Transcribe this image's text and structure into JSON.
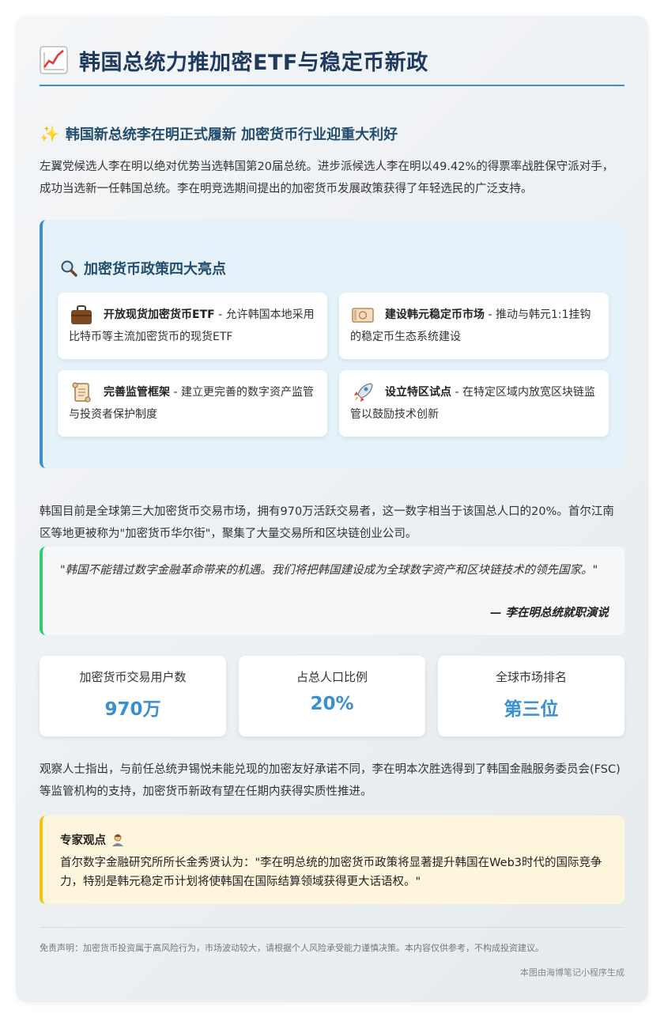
{
  "header": {
    "title": "韩国总统力推加密ETF与稳定币新政",
    "icon": "chart-increasing-icon"
  },
  "section1": {
    "heading": "韩国新总统李在明正式履新 加密货币行业迎重大利好",
    "icon": "sparkles-icon",
    "paragraph": "左翼党候选人李在明以绝对优势当选韩国第20届总统。进步派候选人李在明以49.42%的得票率战胜保守派对手，成功当选新一任韩国总统。李在明竞选期间提出的加密货币发展政策获得了年轻选民的广泛支持。"
  },
  "highlights": {
    "title": "加密货币政策四大亮点",
    "icon": "magnifier-icon",
    "items": [
      {
        "title": "开放现货加密货币ETF",
        "desc": " - 允许韩国本地采用比特币等主流加密货币的现货ETF",
        "icon": "briefcase-icon"
      },
      {
        "title": "建设韩元稳定币市场",
        "desc": " - 推动与韩元1:1挂钩的稳定币生态系统建设",
        "icon": "banknote-icon"
      },
      {
        "title": "完善监管框架",
        "desc": " - 建立更完善的数字资产监管与投资者保护制度",
        "icon": "scroll-icon"
      },
      {
        "title": "设立特区试点",
        "desc": " - 在特定区域内放宽区块链监管以鼓励技术创新",
        "icon": "rocket-icon"
      }
    ]
  },
  "paragraph2": "韩国目前是全球第三大加密货币交易市场，拥有970万活跃交易者，这一数字相当于该国总人口的20%。首尔江南区等地更被称为\"加密货币华尔街\"，聚集了大量交易所和区块链创业公司。",
  "quote": {
    "text": "\"韩国不能错过数字金融革命带来的机遇。我们将把韩国建设成为全球数字资产和区块链技术的领先国家。\"",
    "source": "— 李在明总统就职演说"
  },
  "stats": [
    {
      "label": "加密货币交易用户数",
      "value": "970万"
    },
    {
      "label": "占总人口比例",
      "value": "20%"
    },
    {
      "label": "全球市场排名",
      "value": "第三位"
    }
  ],
  "paragraph3": "观察人士指出，与前任总统尹锡悦未能兑现的加密友好承诺不同，李在明本次胜选得到了韩国金融服务委员会(FSC)等监管机构的支持，加密货币新政有望在任期内获得实质性推进。",
  "expert": {
    "title": "专家观点",
    "icon": "person-icon",
    "text": "首尔数字金融研究所所长金秀贤认为：\"李在明总统的加密货币政策将显著提升韩国在Web3时代的国际竞争力，特别是韩元稳定币计划将使韩国在国际结算领域获得更大话语权。\""
  },
  "disclaimer": "免责声明：加密货币投资属于高风险行为，市场波动较大，请根据个人风险承受能力谨慎决策。本内容仅供参考，不构成投资建议。",
  "footer": "本图由海博笔记小程序生成",
  "colors": {
    "title": "#1e3a5f",
    "accent": "#3d8fc9",
    "stat_value": "#3a8fd1",
    "quote_border": "#2ecc71",
    "expert_border": "#f1c40f"
  }
}
